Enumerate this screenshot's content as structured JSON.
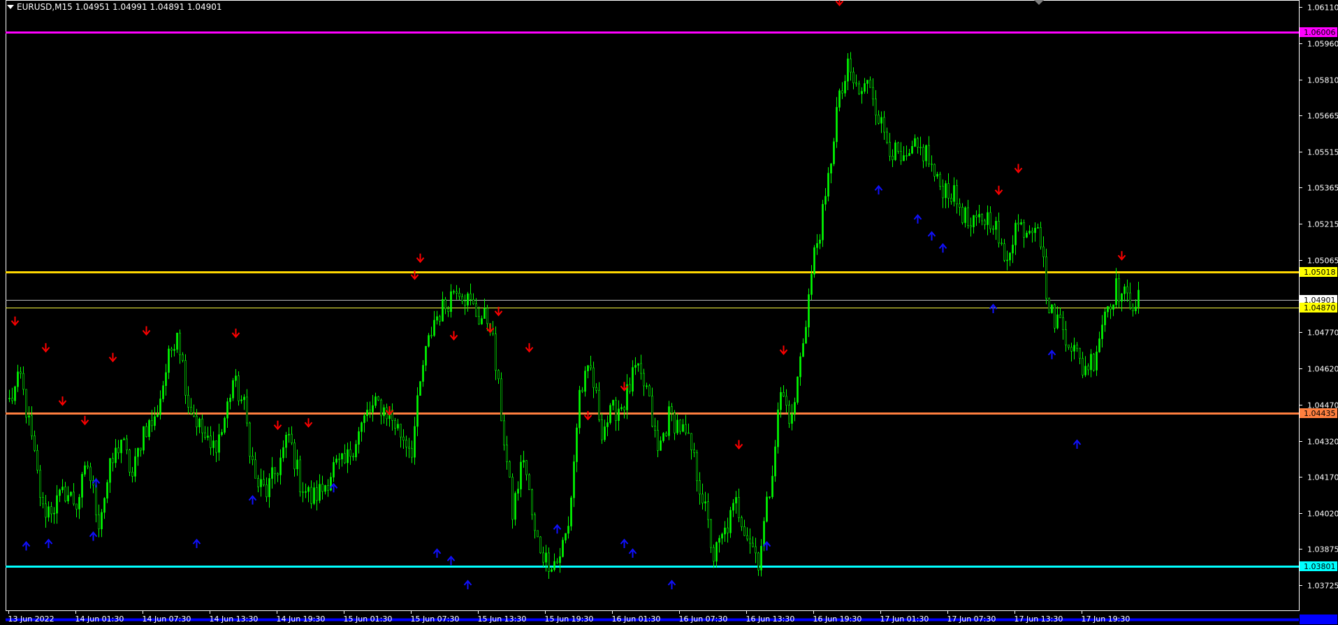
{
  "chart": {
    "title": "EURUSD,M15  1.04951 1.04991 1.04891 1.04901",
    "symbol": "EURUSD",
    "timeframe": "M15",
    "ohlc": {
      "open": 1.04951,
      "high": 1.04991,
      "low": 1.04891,
      "close": 1.04901
    },
    "colors": {
      "background": "#000000",
      "axis_frame": "#ffffff",
      "axis_text": "#ffffff",
      "candle_bull": "#00ff00",
      "candle_bear": "#ffffff",
      "arrow_down": "#ff0000",
      "arrow_up": "#1010ff"
    }
  },
  "chart_data": {
    "type": "candlestick",
    "x_tick_labels": [
      "13 Jun 2022",
      "14 Jun 01:30",
      "14 Jun 07:30",
      "14 Jun 13:30",
      "14 Jun 19:30",
      "15 Jun 01:30",
      "15 Jun 07:30",
      "15 Jun 13:30",
      "15 Jun 19:30",
      "16 Jun 01:30",
      "16 Jun 07:30",
      "16 Jun 13:30",
      "16 Jun 19:30",
      "17 Jun 01:30",
      "17 Jun 07:30",
      "17 Jun 13:30",
      "17 Jun 19:30"
    ],
    "x_tick_index": [
      0,
      24,
      48,
      72,
      96,
      120,
      144,
      168,
      192,
      216,
      240,
      264,
      288,
      312,
      336,
      360,
      384
    ],
    "y_range": [
      1.0362,
      1.0614
    ],
    "y_tick_labels": [
      "1.06110",
      "1.05960",
      "1.05810",
      "1.05665",
      "1.05515",
      "1.05365",
      "1.05215",
      "1.05065",
      "1.04770",
      "1.04620",
      "1.04470",
      "1.04320",
      "1.04170",
      "1.04020",
      "1.03875",
      "1.03725"
    ],
    "horizontal_lines": [
      {
        "price": "1.06006",
        "color": "#ff00ff",
        "label_bg": "#ff00ff",
        "label_fg": "#000000",
        "width": 3
      },
      {
        "price": "1.05018",
        "color": "#ffd700",
        "label_bg": "#ffff00",
        "label_fg": "#000000",
        "width": 3
      },
      {
        "price": "1.04901",
        "color": "#b8b8b8",
        "label_bg": "#ffffff",
        "label_fg": "#000000",
        "width": 1
      },
      {
        "price": "1.04870",
        "color": "#ffff40",
        "label_bg": "#ffff00",
        "label_fg": "#000000",
        "width": 1
      },
      {
        "price": "1.04435",
        "color": "#ff7f3f",
        "label_bg": "#ff7f3f",
        "label_fg": "#000000",
        "width": 3
      },
      {
        "price": "1.03801",
        "color": "#00ffff",
        "label_bg": "#00ffff",
        "label_fg": "#000000",
        "width": 3
      },
      {
        "price": "1.03582",
        "color": "#0000ff",
        "label_bg": "#0000ff",
        "label_fg": "#0000ff",
        "width": 4
      }
    ],
    "price_anchors": [
      [
        0,
        1.0448
      ],
      [
        4,
        1.0458
      ],
      [
        8,
        1.0432
      ],
      [
        12,
        1.0403
      ],
      [
        16,
        1.0405
      ],
      [
        20,
        1.0411
      ],
      [
        24,
        1.0406
      ],
      [
        28,
        1.0422
      ],
      [
        32,
        1.0399
      ],
      [
        36,
        1.042
      ],
      [
        40,
        1.0433
      ],
      [
        44,
        1.0417
      ],
      [
        48,
        1.0437
      ],
      [
        52,
        1.044
      ],
      [
        56,
        1.0461
      ],
      [
        60,
        1.0479
      ],
      [
        64,
        1.0448
      ],
      [
        68,
        1.0438
      ],
      [
        72,
        1.0428
      ],
      [
        76,
        1.0436
      ],
      [
        80,
        1.0457
      ],
      [
        84,
        1.0446
      ],
      [
        88,
        1.0415
      ],
      [
        92,
        1.0411
      ],
      [
        96,
        1.0421
      ],
      [
        100,
        1.0434
      ],
      [
        104,
        1.0415
      ],
      [
        108,
        1.0408
      ],
      [
        112,
        1.0412
      ],
      [
        116,
        1.0421
      ],
      [
        120,
        1.0422
      ],
      [
        124,
        1.0433
      ],
      [
        128,
        1.0443
      ],
      [
        132,
        1.0447
      ],
      [
        136,
        1.0443
      ],
      [
        140,
        1.0435
      ],
      [
        144,
        1.0429
      ],
      [
        148,
        1.0463
      ],
      [
        152,
        1.0482
      ],
      [
        156,
        1.0488
      ],
      [
        160,
        1.0497
      ],
      [
        164,
        1.049
      ],
      [
        168,
        1.0483
      ],
      [
        172,
        1.0482
      ],
      [
        176,
        1.0443
      ],
      [
        180,
        1.0402
      ],
      [
        184,
        1.0426
      ],
      [
        188,
        1.0393
      ],
      [
        192,
        1.0383
      ],
      [
        196,
        1.0382
      ],
      [
        200,
        1.0396
      ],
      [
        204,
        1.0452
      ],
      [
        208,
        1.0461
      ],
      [
        212,
        1.0437
      ],
      [
        216,
        1.0444
      ],
      [
        220,
        1.0448
      ],
      [
        224,
        1.0461
      ],
      [
        228,
        1.0453
      ],
      [
        232,
        1.0427
      ],
      [
        236,
        1.0442
      ],
      [
        240,
        1.0438
      ],
      [
        244,
        1.0428
      ],
      [
        248,
        1.0409
      ],
      [
        252,
        1.0384
      ],
      [
        256,
        1.0394
      ],
      [
        260,
        1.0406
      ],
      [
        264,
        1.0394
      ],
      [
        268,
        1.0383
      ],
      [
        272,
        1.0412
      ],
      [
        276,
        1.0452
      ],
      [
        280,
        1.044
      ],
      [
        284,
        1.0474
      ],
      [
        288,
        1.0509
      ],
      [
        292,
        1.053
      ],
      [
        296,
        1.0568
      ],
      [
        300,
        1.0585
      ],
      [
        304,
        1.0575
      ],
      [
        308,
        1.058
      ],
      [
        312,
        1.0562
      ],
      [
        316,
        1.0552
      ],
      [
        320,
        1.0545
      ],
      [
        324,
        1.0552
      ],
      [
        328,
        1.0551
      ],
      [
        332,
        1.0538
      ],
      [
        336,
        1.0536
      ],
      [
        340,
        1.0529
      ],
      [
        344,
        1.0519
      ],
      [
        348,
        1.0524
      ],
      [
        352,
        1.0524
      ],
      [
        356,
        1.0505
      ],
      [
        360,
        1.0521
      ],
      [
        364,
        1.052
      ],
      [
        368,
        1.0524
      ],
      [
        372,
        1.0485
      ],
      [
        376,
        1.0481
      ],
      [
        380,
        1.0472
      ],
      [
        384,
        1.0462
      ],
      [
        388,
        1.0466
      ],
      [
        392,
        1.0486
      ],
      [
        396,
        1.0495
      ],
      [
        400,
        1.049
      ],
      [
        404,
        1.049
      ]
    ],
    "signal_arrows": [
      {
        "dir": "down",
        "index": 2,
        "price": 1.0481
      },
      {
        "dir": "up",
        "index": 6,
        "price": 1.0389
      },
      {
        "dir": "down",
        "index": 13,
        "price": 1.047
      },
      {
        "dir": "up",
        "index": 14,
        "price": 1.039
      },
      {
        "dir": "down",
        "index": 19,
        "price": 1.0448
      },
      {
        "dir": "up",
        "index": 30,
        "price": 1.0393
      },
      {
        "dir": "down",
        "index": 27,
        "price": 1.044
      },
      {
        "dir": "up",
        "index": 31,
        "price": 1.0415
      },
      {
        "dir": "down",
        "index": 37,
        "price": 1.0466
      },
      {
        "dir": "down",
        "index": 49,
        "price": 1.0477
      },
      {
        "dir": "up",
        "index": 67,
        "price": 1.039
      },
      {
        "dir": "down",
        "index": 81,
        "price": 1.0476
      },
      {
        "dir": "up",
        "index": 87,
        "price": 1.0408
      },
      {
        "dir": "down",
        "index": 96,
        "price": 1.0438
      },
      {
        "dir": "up",
        "index": 116,
        "price": 1.0413
      },
      {
        "dir": "down",
        "index": 107,
        "price": 1.0439
      },
      {
        "dir": "down",
        "index": 136,
        "price": 1.0444
      },
      {
        "dir": "down",
        "index": 145,
        "price": 1.05
      },
      {
        "dir": "down",
        "index": 147,
        "price": 1.0507
      },
      {
        "dir": "up",
        "index": 153,
        "price": 1.0386
      },
      {
        "dir": "up",
        "index": 158,
        "price": 1.0383
      },
      {
        "dir": "down",
        "index": 159,
        "price": 1.0475
      },
      {
        "dir": "up",
        "index": 164,
        "price": 1.0373
      },
      {
        "dir": "down",
        "index": 172,
        "price": 1.0478
      },
      {
        "dir": "down",
        "index": 175,
        "price": 1.0485
      },
      {
        "dir": "down",
        "index": 186,
        "price": 1.047
      },
      {
        "dir": "up",
        "index": 196,
        "price": 1.0396
      },
      {
        "dir": "down",
        "index": 207,
        "price": 1.0442
      },
      {
        "dir": "up",
        "index": 220,
        "price": 1.039
      },
      {
        "dir": "down",
        "index": 220,
        "price": 1.0454
      },
      {
        "dir": "up",
        "index": 223,
        "price": 1.0386
      },
      {
        "dir": "up",
        "index": 237,
        "price": 1.0373
      },
      {
        "dir": "down",
        "index": 261,
        "price": 1.043
      },
      {
        "dir": "up",
        "index": 271,
        "price": 1.0389
      },
      {
        "dir": "down",
        "index": 277,
        "price": 1.0469
      },
      {
        "dir": "down",
        "index": 297,
        "price": 1.0613
      },
      {
        "dir": "up",
        "index": 311,
        "price": 1.0536
      },
      {
        "dir": "up",
        "index": 325,
        "price": 1.0524
      },
      {
        "dir": "up",
        "index": 330,
        "price": 1.0517
      },
      {
        "dir": "up",
        "index": 334,
        "price": 1.0512
      },
      {
        "dir": "down",
        "index": 354,
        "price": 1.0535
      },
      {
        "dir": "down",
        "index": 361,
        "price": 1.0544
      },
      {
        "dir": "up",
        "index": 352,
        "price": 1.0487
      },
      {
        "dir": "up",
        "index": 373,
        "price": 1.0468
      },
      {
        "dir": "up",
        "index": 382,
        "price": 1.0431
      },
      {
        "dir": "down",
        "index": 398,
        "price": 1.0508
      }
    ]
  }
}
